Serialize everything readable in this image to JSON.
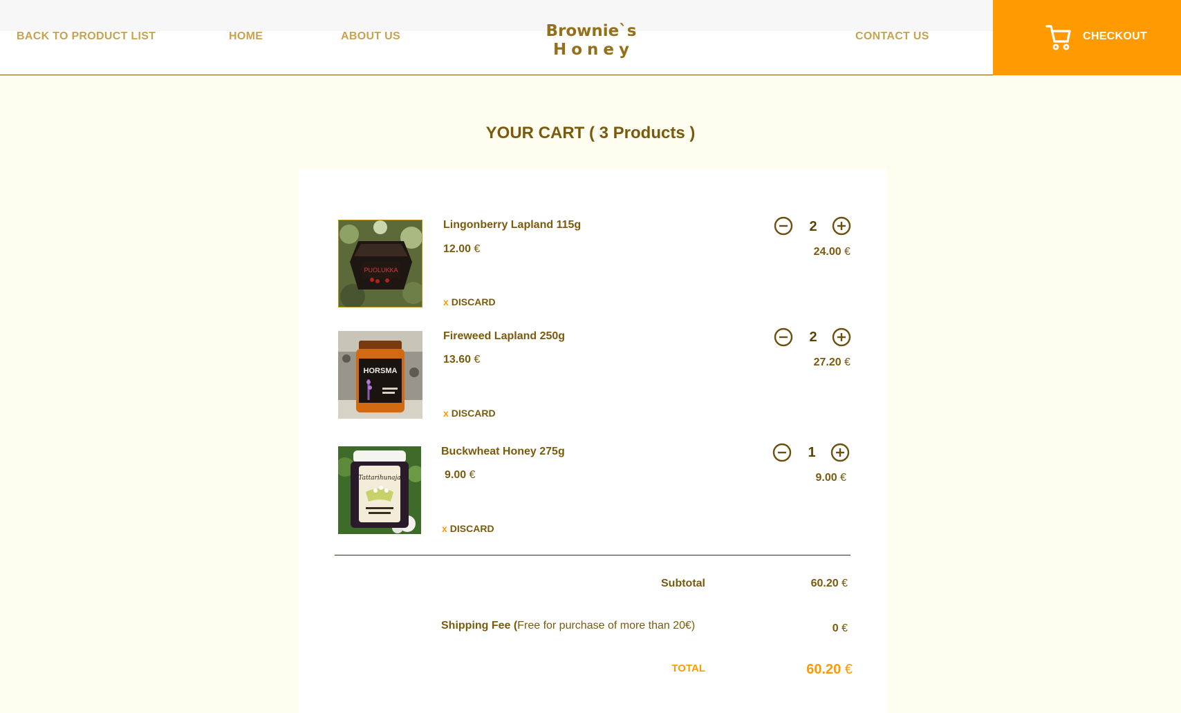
{
  "header": {
    "nav_back": "BACK TO  PRODUCT LIST",
    "nav_home": "HOME",
    "nav_about": "ABOUT US",
    "nav_contact": "CONTACT US",
    "logo_line1": "Brownie`s",
    "logo_line2": "Honey",
    "checkout_label": "CHECKOUT",
    "checkout_icon": "cart-icon"
  },
  "cart": {
    "title": "YOUR CART ( 3 Products )",
    "currency": "€",
    "discard_x": "x",
    "discard_label": "DISCARD",
    "items": [
      {
        "name": "Lingonberry Lapland 115g",
        "price": "12.00",
        "qty": "2",
        "line_total": "24.00",
        "jar_label": "PUOLUKKA"
      },
      {
        "name": "Fireweed Lapland 250g",
        "price": "13.60",
        "qty": "2",
        "line_total": "27.20",
        "jar_label": "HORSMA"
      },
      {
        "name": "Buckwheat Honey 275g",
        "price": "9.00",
        "qty": "1",
        "line_total": "9.00",
        "jar_label": "Tattarihunaja"
      }
    ]
  },
  "summary": {
    "subtotal_label": "Subtotal",
    "subtotal_value": "60.20",
    "shipping_label": "Shipping Fee (",
    "shipping_note": "Free for purchase of more than 20€)",
    "shipping_value": "0",
    "total_label": "TOTAL",
    "total_value": "60.20"
  },
  "colors": {
    "accent": "#ff9a00",
    "brand_brown": "#7a5a0c",
    "nav_gold": "#c8a24c",
    "background": "#fefdf0"
  }
}
